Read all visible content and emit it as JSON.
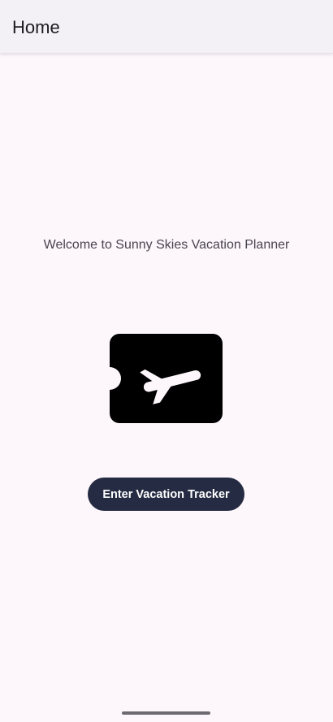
{
  "app_bar": {
    "title": "Home"
  },
  "main": {
    "welcome_text": "Welcome to Sunny Skies Vacation Planner",
    "illustration_icon": "airplane-ticket-icon",
    "enter_button_label": "Enter Vacation Tracker"
  },
  "colors": {
    "background": "#fdf7fc",
    "app_bar": "#f3f0f6",
    "button": "#252b42",
    "button_text": "#ffffff",
    "icon": "#000000"
  }
}
